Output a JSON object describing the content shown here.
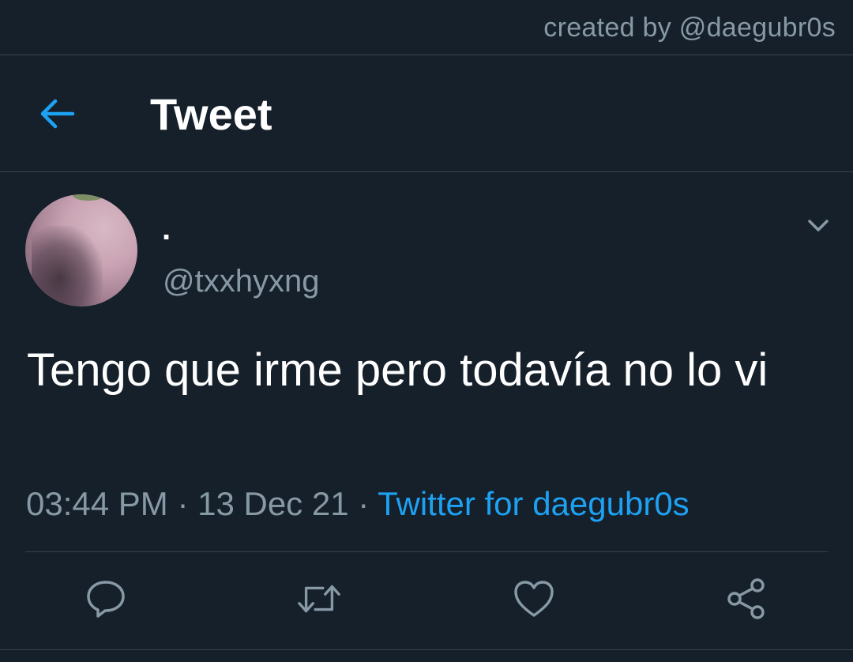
{
  "credit": "created by @daegubr0s",
  "header": {
    "title": "Tweet",
    "back_icon": "arrow-left-icon"
  },
  "author": {
    "display_name": ".",
    "handle": "@txxhyxng",
    "menu_icon": "chevron-down-icon"
  },
  "tweet": {
    "text": "Tengo que irme pero todavía no lo vi",
    "time": "03:44 PM",
    "separator": " · ",
    "date": "13 Dec 21",
    "source": "Twitter for daegubr0s"
  },
  "actions": [
    {
      "name": "reply",
      "icon": "reply-icon"
    },
    {
      "name": "retweet",
      "icon": "retweet-icon"
    },
    {
      "name": "like",
      "icon": "heart-icon"
    },
    {
      "name": "share",
      "icon": "share-icon"
    }
  ],
  "colors": {
    "background": "#15202b",
    "accent": "#1da1f2",
    "secondary_text": "#8899a6",
    "divider": "#38444d"
  }
}
